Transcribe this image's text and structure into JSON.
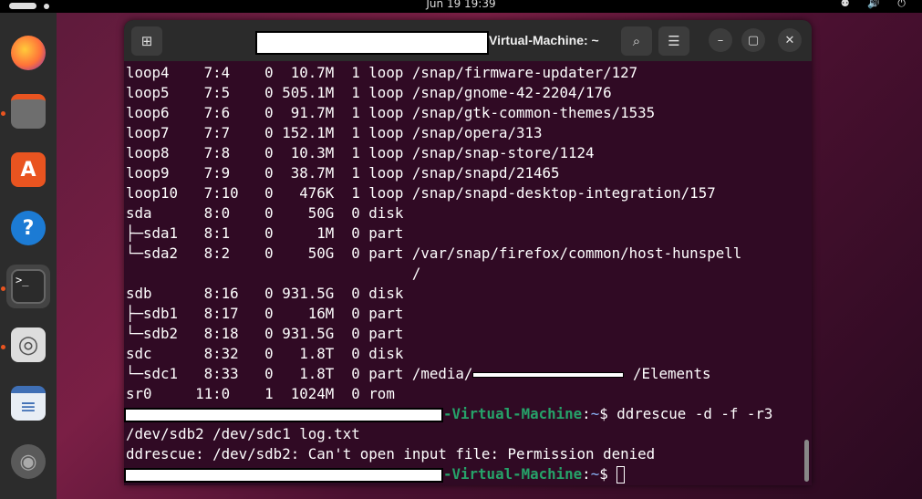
{
  "topbar": {
    "clock": "Jun 19  19:39",
    "system_icons": "⚉ 🔊 ⏻"
  },
  "dock": {
    "items": [
      {
        "name": "firefox",
        "glyph": "🦊"
      },
      {
        "name": "files",
        "glyph": "▭"
      },
      {
        "name": "app-center",
        "glyph": "A"
      },
      {
        "name": "help",
        "glyph": "?"
      },
      {
        "name": "terminal",
        "glyph": ">_"
      },
      {
        "name": "disks",
        "glyph": "◎"
      },
      {
        "name": "text-editor",
        "glyph": "≡"
      },
      {
        "name": "disc",
        "glyph": "◉"
      }
    ]
  },
  "window": {
    "title": "Virtual-Machine: ~",
    "buttons": {
      "new_tab": "⊞",
      "search": "⌕",
      "menu": "☰",
      "minimize": "–",
      "maximize": "▢",
      "close": "✕"
    }
  },
  "terminal": {
    "lines": [
      "loop4    7:4    0  10.7M  1 loop /snap/firmware-updater/127",
      "loop5    7:5    0 505.1M  1 loop /snap/gnome-42-2204/176",
      "loop6    7:6    0  91.7M  1 loop /snap/gtk-common-themes/1535",
      "loop7    7:7    0 152.1M  1 loop /snap/opera/313",
      "loop8    7:8    0  10.3M  1 loop /snap/snap-store/1124",
      "loop9    7:9    0  38.7M  1 loop /snap/snapd/21465",
      "loop10   7:10   0   476K  1 loop /snap/snapd-desktop-integration/157",
      "sda      8:0    0    50G  0 disk",
      "├─sda1   8:1    0     1M  0 part",
      "└─sda2   8:2    0    50G  0 part /var/snap/firefox/common/host-hunspell",
      "                                 /",
      "sdb      8:16   0 931.5G  0 disk",
      "├─sdb1   8:17   0    16M  0 part",
      "└─sdb2   8:18   0 931.5G  0 part",
      "sdc      8:32   0   1.8T  0 disk",
      "└─sdc1   8:33   0   1.8T  0 part /media/",
      "sr0     11:0    1  1024M  0 rom"
    ],
    "sdc1_suffix": "/Elements",
    "prompt_host": "-Virtual-Machine",
    "prompt_sep": ":",
    "prompt_path": "~",
    "prompt_end": "$ ",
    "command1": "ddrescue -d -f -r3",
    "command1_cont": "/dev/sdb2 /dev/sdc1 log.txt",
    "error": "ddrescue: /dev/sdb2: Can't open input file: Permission denied"
  }
}
